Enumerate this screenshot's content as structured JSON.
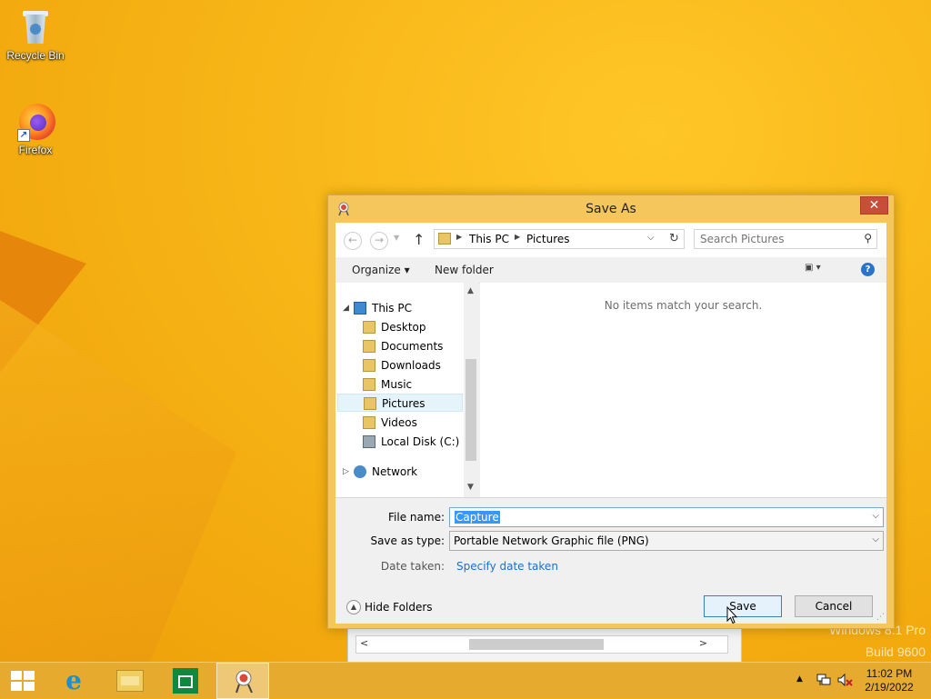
{
  "desktop": {
    "icons": [
      {
        "label": "Recycle Bin",
        "icon": "recycle-bin-icon"
      },
      {
        "label": "Firefox",
        "icon": "firefox-icon"
      }
    ],
    "watermark_line1": "Windows 8.1 Pro",
    "watermark_line2": "Build 9600"
  },
  "dialog": {
    "title": "Save As",
    "close_glyph": "✕",
    "nav": {
      "back_glyph": "←",
      "forward_glyph": "→",
      "recent_glyph": "▼",
      "up_glyph": "↑",
      "address_items": [
        "This PC",
        "Pictures"
      ],
      "address_sep": "▶",
      "address_drop": "⌵",
      "refresh_glyph": "↻",
      "search_placeholder": "Search Pictures",
      "search_glyph": "⚲"
    },
    "commands": {
      "organize": "Organize ▾",
      "new_folder": "New folder",
      "view_glyph": "▣ ▾",
      "help_glyph": "?"
    },
    "tree": [
      {
        "label": "This PC",
        "icon": "this-pc-icon",
        "selected": false
      },
      {
        "label": "Desktop",
        "icon": "folder-icon",
        "selected": false
      },
      {
        "label": "Documents",
        "icon": "folder-icon",
        "selected": false
      },
      {
        "label": "Downloads",
        "icon": "folder-icon",
        "selected": false
      },
      {
        "label": "Music",
        "icon": "folder-icon",
        "selected": false
      },
      {
        "label": "Pictures",
        "icon": "folder-icon",
        "selected": true
      },
      {
        "label": "Videos",
        "icon": "folder-icon",
        "selected": false
      },
      {
        "label": "Local Disk (C:)",
        "icon": "disk-icon",
        "selected": false
      },
      {
        "label": "Network",
        "icon": "network-icon",
        "selected": false
      }
    ],
    "empty_message": "No items match your search.",
    "file_name_label": "File name:",
    "file_name_value": "Capture",
    "save_type_label": "Save as type:",
    "save_type_value": "Portable Network Graphic file (PNG)",
    "date_taken_label": "Date taken:",
    "date_taken_link": "Specify date taken",
    "hide_folders": "Hide Folders",
    "save_button": "Save",
    "cancel_button": "Cancel"
  },
  "taskbar": {
    "apps": [
      "start-icon",
      "internet-explorer-icon",
      "file-explorer-icon",
      "store-icon",
      "snipping-tool-icon"
    ],
    "active_app": "snipping-tool-icon",
    "tray_up_glyph": "▲",
    "clock_time": "11:02 PM",
    "clock_date": "2/19/2022"
  }
}
